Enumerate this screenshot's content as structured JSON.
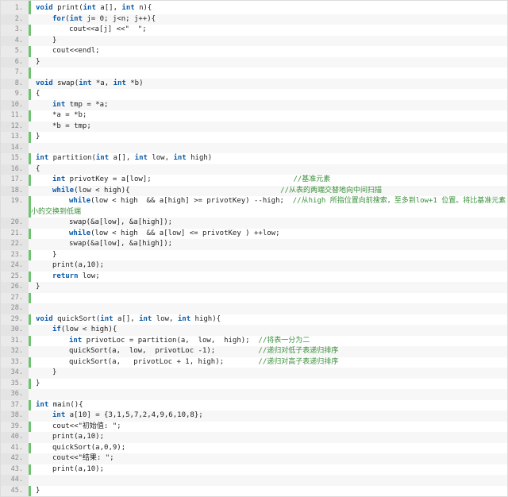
{
  "lines": [
    {
      "n": "1.",
      "indent": 0,
      "parts": [
        [
          "kw",
          "void"
        ],
        [
          "t",
          " print("
        ],
        [
          "kw",
          "int"
        ],
        [
          "t",
          " a[], "
        ],
        [
          "kw",
          "int"
        ],
        [
          "t",
          " n){"
        ]
      ]
    },
    {
      "n": "2.",
      "indent": 1,
      "parts": [
        [
          "kw",
          "for"
        ],
        [
          "t",
          "("
        ],
        [
          "kw",
          "int"
        ],
        [
          "t",
          " j= 0; j<n; j++){"
        ]
      ]
    },
    {
      "n": "3.",
      "indent": 2,
      "parts": [
        [
          "t",
          "cout<<a[j] <<\"  \";"
        ]
      ]
    },
    {
      "n": "4.",
      "indent": 1,
      "parts": [
        [
          "t",
          "}"
        ]
      ]
    },
    {
      "n": "5.",
      "indent": 1,
      "parts": [
        [
          "t",
          "cout<<endl;"
        ]
      ]
    },
    {
      "n": "6.",
      "indent": 0,
      "parts": [
        [
          "t",
          "}"
        ]
      ]
    },
    {
      "n": "7.",
      "indent": 0,
      "parts": []
    },
    {
      "n": "8.",
      "indent": 0,
      "parts": [
        [
          "kw",
          "void"
        ],
        [
          "t",
          " swap("
        ],
        [
          "kw",
          "int"
        ],
        [
          "t",
          " *a, "
        ],
        [
          "kw",
          "int"
        ],
        [
          "t",
          " *b)"
        ]
      ]
    },
    {
      "n": "9.",
      "indent": 0,
      "parts": [
        [
          "t",
          "{"
        ]
      ]
    },
    {
      "n": "10.",
      "indent": 1,
      "parts": [
        [
          "kw",
          "int"
        ],
        [
          "t",
          " tmp = *a;"
        ]
      ]
    },
    {
      "n": "11.",
      "indent": 1,
      "parts": [
        [
          "t",
          "*a = *b;"
        ]
      ]
    },
    {
      "n": "12.",
      "indent": 1,
      "parts": [
        [
          "t",
          "*b = tmp;"
        ]
      ]
    },
    {
      "n": "13.",
      "indent": 0,
      "parts": [
        [
          "t",
          "}"
        ]
      ]
    },
    {
      "n": "14.",
      "indent": 0,
      "parts": []
    },
    {
      "n": "15.",
      "indent": 0,
      "parts": [
        [
          "kw",
          "int"
        ],
        [
          "t",
          " partition("
        ],
        [
          "kw",
          "int"
        ],
        [
          "t",
          " a[], "
        ],
        [
          "kw",
          "int"
        ],
        [
          "t",
          " low, "
        ],
        [
          "kw",
          "int"
        ],
        [
          "t",
          " high)"
        ]
      ]
    },
    {
      "n": "16.",
      "indent": 0,
      "parts": [
        [
          "t",
          "{"
        ]
      ]
    },
    {
      "n": "17.",
      "indent": 1,
      "parts": [
        [
          "kw",
          "int"
        ],
        [
          "t",
          " privotKey = a[low];                                 "
        ],
        [
          "cm",
          "//基准元素"
        ]
      ]
    },
    {
      "n": "18.",
      "indent": 1,
      "parts": [
        [
          "kw",
          "while"
        ],
        [
          "t",
          "(low < high){                                   "
        ],
        [
          "cm",
          "//从表的两端交替地向中间扫描"
        ]
      ]
    },
    {
      "n": "19.",
      "indent": 2,
      "parts": [
        [
          "kw",
          "while"
        ],
        [
          "t",
          "(low < high  && a[high] >= privotKey) --high;  "
        ],
        [
          "cm",
          "//从high 所指位置向前搜索，至多到low+1 位置。将比基准元素"
        ]
      ],
      "cont": "小的交换到低端"
    },
    {
      "n": "20.",
      "indent": 2,
      "parts": [
        [
          "t",
          "swap(&a[low], &a[high]);"
        ]
      ]
    },
    {
      "n": "21.",
      "indent": 2,
      "parts": [
        [
          "kw",
          "while"
        ],
        [
          "t",
          "(low < high  && a[low] <= privotKey ) ++low;"
        ]
      ]
    },
    {
      "n": "22.",
      "indent": 2,
      "parts": [
        [
          "t",
          "swap(&a[low], &a[high]);"
        ]
      ]
    },
    {
      "n": "23.",
      "indent": 1,
      "parts": [
        [
          "t",
          "}"
        ]
      ]
    },
    {
      "n": "24.",
      "indent": 1,
      "parts": [
        [
          "t",
          "print(a,10);"
        ]
      ]
    },
    {
      "n": "25.",
      "indent": 1,
      "parts": [
        [
          "kw",
          "return"
        ],
        [
          "t",
          " low;"
        ]
      ]
    },
    {
      "n": "26.",
      "indent": 0,
      "parts": [
        [
          "t",
          "}"
        ]
      ]
    },
    {
      "n": "27.",
      "indent": 0,
      "parts": []
    },
    {
      "n": "28.",
      "indent": 0,
      "parts": []
    },
    {
      "n": "29.",
      "indent": 0,
      "parts": [
        [
          "kw",
          "void"
        ],
        [
          "t",
          " quickSort("
        ],
        [
          "kw",
          "int"
        ],
        [
          "t",
          " a[], "
        ],
        [
          "kw",
          "int"
        ],
        [
          "t",
          " low, "
        ],
        [
          "kw",
          "int"
        ],
        [
          "t",
          " high){"
        ]
      ]
    },
    {
      "n": "30.",
      "indent": 1,
      "parts": [
        [
          "kw",
          "if"
        ],
        [
          "t",
          "(low < high){"
        ]
      ]
    },
    {
      "n": "31.",
      "indent": 2,
      "parts": [
        [
          "kw",
          "int"
        ],
        [
          "t",
          " privotLoc = partition(a,  low,  high);  "
        ],
        [
          "cm",
          "//将表一分为二"
        ]
      ]
    },
    {
      "n": "32.",
      "indent": 2,
      "parts": [
        [
          "t",
          "quickSort(a,  low,  privotLoc -1);          "
        ],
        [
          "cm",
          "//递归对低子表递归排序"
        ]
      ]
    },
    {
      "n": "33.",
      "indent": 2,
      "parts": [
        [
          "t",
          "quickSort(a,   privotLoc + 1, high);        "
        ],
        [
          "cm",
          "//递归对高子表递归排序"
        ]
      ]
    },
    {
      "n": "34.",
      "indent": 1,
      "parts": [
        [
          "t",
          "}"
        ]
      ]
    },
    {
      "n": "35.",
      "indent": 0,
      "parts": [
        [
          "t",
          "}"
        ]
      ]
    },
    {
      "n": "36.",
      "indent": 0,
      "parts": []
    },
    {
      "n": "37.",
      "indent": 0,
      "parts": [
        [
          "kw",
          "int"
        ],
        [
          "t",
          " main(){"
        ]
      ]
    },
    {
      "n": "38.",
      "indent": 1,
      "parts": [
        [
          "kw",
          "int"
        ],
        [
          "t",
          " a[10] = {3,1,5,7,2,4,9,6,10,8};"
        ]
      ]
    },
    {
      "n": "39.",
      "indent": 1,
      "parts": [
        [
          "t",
          "cout<<\"初始值: \";"
        ]
      ]
    },
    {
      "n": "40.",
      "indent": 1,
      "parts": [
        [
          "t",
          "print(a,10);"
        ]
      ]
    },
    {
      "n": "41.",
      "indent": 1,
      "parts": [
        [
          "t",
          "quickSort(a,0,9);"
        ]
      ]
    },
    {
      "n": "42.",
      "indent": 1,
      "parts": [
        [
          "t",
          "cout<<\"结果: \";"
        ]
      ]
    },
    {
      "n": "43.",
      "indent": 1,
      "parts": [
        [
          "t",
          "print(a,10);"
        ]
      ]
    },
    {
      "n": "44.",
      "indent": 0,
      "parts": []
    },
    {
      "n": "45.",
      "indent": 0,
      "parts": [
        [
          "t",
          "}"
        ]
      ]
    }
  ]
}
